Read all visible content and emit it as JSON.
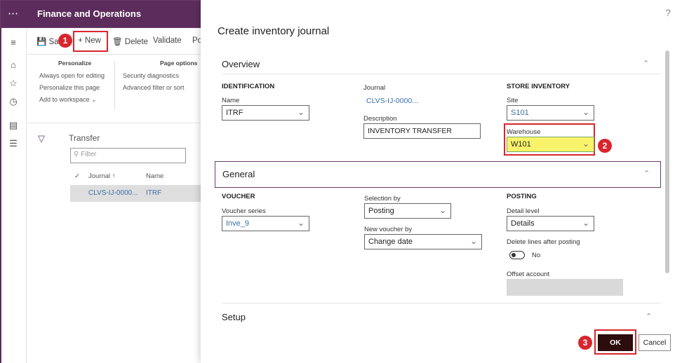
{
  "app": {
    "title": "Finance and Operations"
  },
  "actionbar": {
    "save": "Save",
    "new": "New",
    "delete": "Delete",
    "validate": "Validate",
    "post": "Po"
  },
  "ribbon": {
    "personalize_head": "Personalize",
    "always_open": "Always open for editing",
    "personalize_page": "Personalize this page",
    "add_workspace": "Add to workspace",
    "page_options_head": "Page options",
    "security_diag": "Security diagnostics",
    "adv_filter": "Advanced filter or sort"
  },
  "list": {
    "title": "Transfer",
    "filter_placeholder": "Filter",
    "col_journal": "Journal",
    "col_name": "Name",
    "row_journal": "CLVS-IJ-0000...",
    "row_name": "ITRF"
  },
  "dialog": {
    "title": "Create inventory journal",
    "help": "?",
    "overview": {
      "title": "Overview",
      "identification_head": "IDENTIFICATION",
      "name_label": "Name",
      "name_value": "ITRF",
      "journal_label": "Journal",
      "journal_value": "CLVS-IJ-0000...",
      "description_label": "Description",
      "description_value": "INVENTORY TRANSFER",
      "store_head": "STORE INVENTORY",
      "site_label": "Site",
      "site_value": "S101",
      "warehouse_label": "Warehouse",
      "warehouse_value": "W101"
    },
    "general": {
      "title": "General",
      "voucher_head": "VOUCHER",
      "voucher_series_label": "Voucher series",
      "voucher_series_value": "Inve_9",
      "selection_label": "Selection by",
      "selection_value": "Posting",
      "new_voucher_label": "New voucher by",
      "new_voucher_value": "Change date",
      "posting_head": "POSTING",
      "detail_label": "Detail level",
      "detail_value": "Details",
      "delete_lines_label": "Delete lines after posting",
      "delete_lines_value": "No",
      "offset_label": "Offset account"
    },
    "setup": {
      "title": "Setup"
    },
    "ok": "OK",
    "cancel": "Cancel"
  },
  "badges": {
    "one": "1",
    "two": "2",
    "three": "3"
  },
  "colors": {
    "brand": "#5c2d5c",
    "highlight": "#d8262e",
    "warehouse_fill": "#f8f36a",
    "ok_button": "#2c0c0c"
  }
}
